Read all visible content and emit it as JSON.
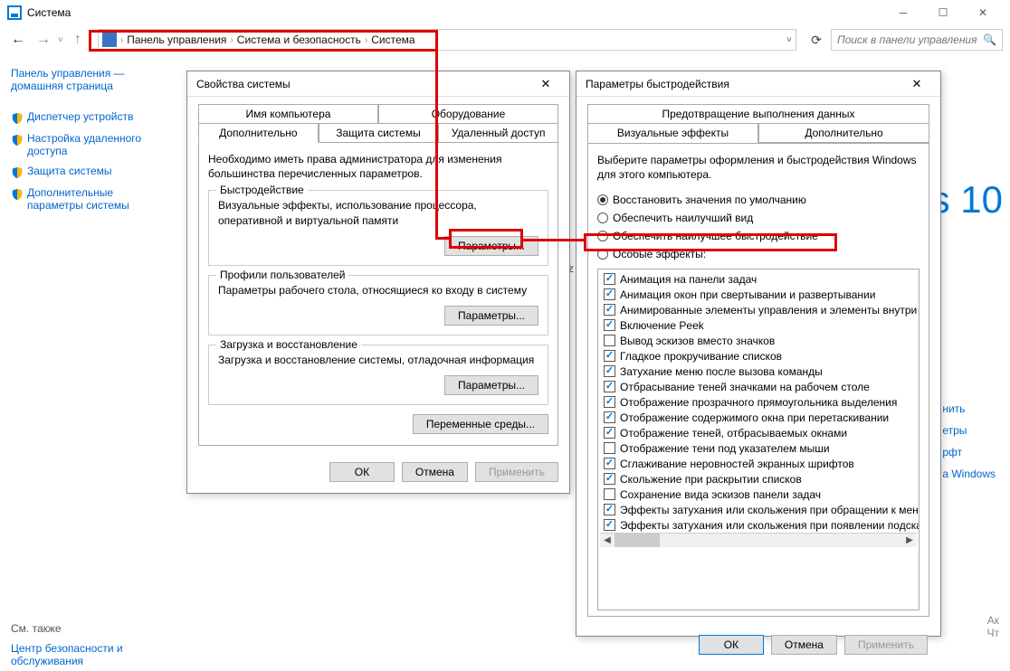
{
  "window_title": "Система",
  "breadcrumb": [
    "Панель управления",
    "Система и безопасность",
    "Система"
  ],
  "search_placeholder": "Поиск в панели управления",
  "sidebar": {
    "home": "Панель управления — домашняя страница",
    "items": [
      "Диспетчер устройств",
      "Настройка удаленного доступа",
      "Защита системы",
      "Дополнительные параметры системы"
    ],
    "see_also_label": "См. также",
    "see_also_link": "Центр безопасности и обслуживания"
  },
  "background": {
    "win10": "s 10",
    "hz": "Hz",
    "links": [
      "нить",
      "етры",
      "рфт",
      "а Windows"
    ],
    "activation": [
      "Ак",
      "Чт"
    ]
  },
  "dlg1": {
    "title": "Свойства системы",
    "tabs_top": [
      "Имя компьютера",
      "Оборудование"
    ],
    "tabs_bottom": [
      "Дополнительно",
      "Защита системы",
      "Удаленный доступ"
    ],
    "intro": "Необходимо иметь права администратора для изменения большинства перечисленных параметров.",
    "groups": [
      {
        "title": "Быстродействие",
        "text": "Визуальные эффекты, использование процессора, оперативной и виртуальной памяти",
        "btn": "Параметры..."
      },
      {
        "title": "Профили пользователей",
        "text": "Параметры рабочего стола, относящиеся ко входу в систему",
        "btn": "Параметры..."
      },
      {
        "title": "Загрузка и восстановление",
        "text": "Загрузка и восстановление системы, отладочная информация",
        "btn": "Параметры..."
      }
    ],
    "env_btn": "Переменные среды...",
    "footer": {
      "ok": "ОК",
      "cancel": "Отмена",
      "apply": "Применить"
    }
  },
  "dlg2": {
    "title": "Параметры быстродействия",
    "tab_top": "Предотвращение выполнения данных",
    "tab_left": "Визуальные эффекты",
    "tab_right": "Дополнительно",
    "intro": "Выберите параметры оформления и быстродействия Windows для этого компьютера.",
    "radios": [
      {
        "label": "Восстановить значения по умолчанию",
        "checked": true
      },
      {
        "label": "Обеспечить наилучший вид",
        "checked": false
      },
      {
        "label": "Обеспечить наилучшее быстродействие",
        "checked": false
      },
      {
        "label": "Особые эффекты:",
        "checked": false
      }
    ],
    "checks": [
      {
        "label": "Анимация на панели задач",
        "checked": true
      },
      {
        "label": "Анимация окон при свертывании и развертывании",
        "checked": true
      },
      {
        "label": "Анимированные элементы управления и элементы внутри окн",
        "checked": true
      },
      {
        "label": "Включение Peek",
        "checked": true
      },
      {
        "label": "Вывод эскизов вместо значков",
        "checked": false
      },
      {
        "label": "Гладкое прокручивание списков",
        "checked": true
      },
      {
        "label": "Затухание меню после вызова команды",
        "checked": true
      },
      {
        "label": "Отбрасывание теней значками на рабочем столе",
        "checked": true
      },
      {
        "label": "Отображение прозрачного прямоугольника выделения",
        "checked": true
      },
      {
        "label": "Отображение содержимого окна при перетаскивании",
        "checked": true
      },
      {
        "label": "Отображение теней, отбрасываемых окнами",
        "checked": true
      },
      {
        "label": "Отображение тени под указателем мыши",
        "checked": false
      },
      {
        "label": "Сглаживание неровностей экранных шрифтов",
        "checked": true
      },
      {
        "label": "Скольжение при раскрытии списков",
        "checked": true
      },
      {
        "label": "Сохранение вида эскизов панели задач",
        "checked": false
      },
      {
        "label": "Эффекты затухания или скольжения при обращении к меню",
        "checked": true
      },
      {
        "label": "Эффекты затухания или скольжения при появлении подсказок",
        "checked": true
      }
    ],
    "footer": {
      "ok": "ОК",
      "cancel": "Отмена",
      "apply": "Применить"
    }
  }
}
